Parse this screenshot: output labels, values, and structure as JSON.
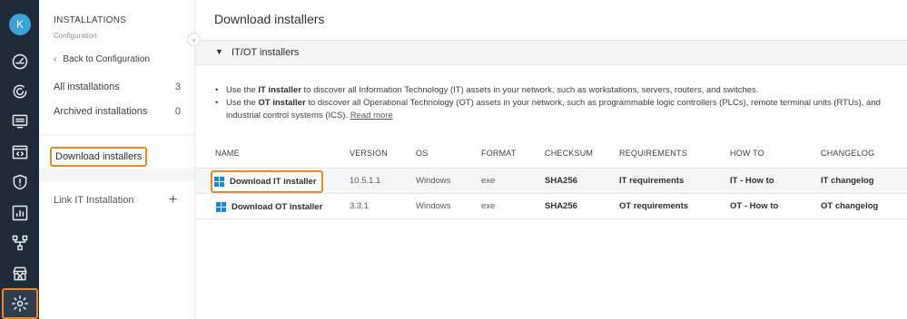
{
  "rail": {
    "avatar_letter": "K",
    "icons": [
      "dashboard-icon",
      "guardicore-icon",
      "inventory-icon",
      "code-window-icon",
      "shield-alert-icon",
      "reports-icon",
      "network-icon",
      "store-icon",
      "settings-icon"
    ]
  },
  "sidebar": {
    "title": "INSTALLATIONS",
    "subtitle": "Configuration",
    "back_label": "Back to Configuration",
    "items": [
      {
        "label": "All installations",
        "count": "3"
      },
      {
        "label": "Archived installations",
        "count": "0"
      }
    ],
    "active_label": "Download installers",
    "link_label": "Link IT Installation"
  },
  "main": {
    "title": "Download installers",
    "section_label": "IT/OT installers",
    "bullet1": {
      "pre": "Use the ",
      "strong": "IT installer",
      "post": " to discover all Information Technology (IT) assets in your network, such as workstations, servers, routers, and switches."
    },
    "bullet2": {
      "pre": "Use the ",
      "strong": "OT installer",
      "post": " to discover all Operational Technology (OT) assets in your network, such as programmable logic controllers (PLCs), remote terminal units (RTUs), and industrial control systems (ICS). ",
      "link": "Read more"
    },
    "columns": [
      "NAME",
      "VERSION",
      "OS",
      "FORMAT",
      "CHECKSUM",
      "REQUIREMENTS",
      "HOW TO",
      "CHANGELOG"
    ],
    "rows": [
      {
        "name": "Download IT installer",
        "version": "10.5.1.1",
        "os": "Windows",
        "format": "exe",
        "checksum": "SHA256",
        "requirements": "IT requirements",
        "howto": "IT - How to",
        "changelog": "IT changelog"
      },
      {
        "name": "Download OT installer",
        "version": "3.3.1",
        "os": "Windows",
        "format": "exe",
        "checksum": "SHA256",
        "requirements": "OT requirements",
        "howto": "OT - How to",
        "changelog": "OT changelog"
      }
    ]
  },
  "colors": {
    "rail_bg": "#1f2b38",
    "highlight": "#e8892a",
    "avatar": "#3aa3d8",
    "windows_blue": "#1a86d6"
  }
}
